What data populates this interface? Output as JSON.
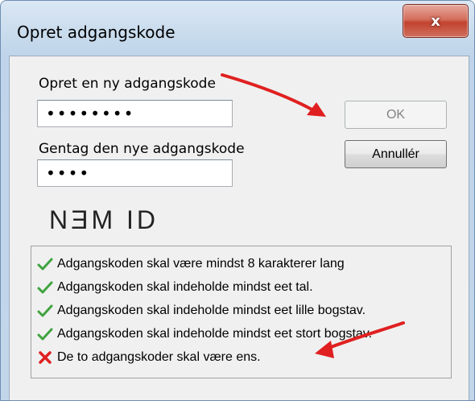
{
  "dialog": {
    "title": "Opret adgangskode",
    "close_label": "x"
  },
  "form": {
    "new_password_label": "Opret en ny adgangskode",
    "new_password_value": "••••••••",
    "repeat_password_label": "Gentag den nye adgangskode",
    "repeat_password_value": "••••"
  },
  "buttons": {
    "ok_label": "OK",
    "ok_enabled": false,
    "cancel_label": "Annullér"
  },
  "logo": {
    "text": "NƎM ID"
  },
  "rules": [
    {
      "text": "Adgangskoden skal være mindst 8 karakterer lang",
      "status": "ok"
    },
    {
      "text": "Adgangskoden skal indeholde mindst eet tal.",
      "status": "ok"
    },
    {
      "text": "Adgangskoden skal indeholde mindst eet lille bogstav.",
      "status": "ok"
    },
    {
      "text": "Adgangskoden skal indeholde mindst eet stort bogstav.",
      "status": "ok"
    },
    {
      "text": "De to adgangskoder skal være ens.",
      "status": "fail"
    }
  ],
  "colors": {
    "ok_check": "#3fa33f",
    "fail_cross": "#e02020",
    "arrow": "#e02020"
  }
}
